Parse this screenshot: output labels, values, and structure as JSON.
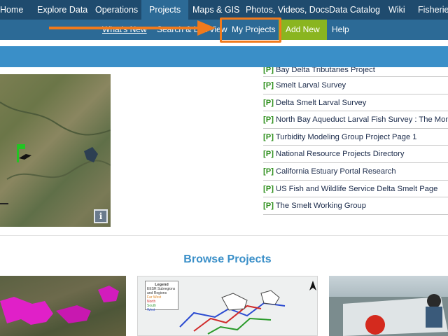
{
  "topnav": {
    "items": [
      "Home",
      "Explore Data",
      "Operations",
      "Projects",
      "Maps & GIS",
      "Photos, Videos, Docs",
      "Data Catalog",
      "Wiki",
      "Fisheries"
    ]
  },
  "subnav": {
    "items": [
      "What's New",
      "Search & List View",
      "My Projects",
      "Add New",
      "Help"
    ]
  },
  "links": {
    "items": [
      "Bay Delta Tributaries Project",
      "Smelt Larval Survey",
      "Delta Smelt Larval Survey",
      "North Bay Aqueduct Larval Fish Survey : The Monitoring",
      "Turbidity Modeling Group Project Page 1",
      "National Resource Projects Directory",
      "California Estuary Portal Research",
      "US Fish and Wildlife Service Delta Smelt Page",
      "The Smelt Working Group"
    ],
    "tag": "[P]"
  },
  "map": {
    "info_label": "i"
  },
  "browse": {
    "title": "Browse Projects",
    "legend_title": "Legend",
    "legend_subtitle": "EESR Subregions and Regions",
    "legend_items": [
      "Far West",
      "North",
      "South",
      "West"
    ]
  },
  "colors": {
    "topnav_bg": "#1f4b6e",
    "subnav_bg": "#2c6a96",
    "banner_bg": "#3a8fc8",
    "add_new_bg": "#8ab520",
    "annotation": "#f07a1c",
    "tag_green": "#2e8f1c"
  }
}
